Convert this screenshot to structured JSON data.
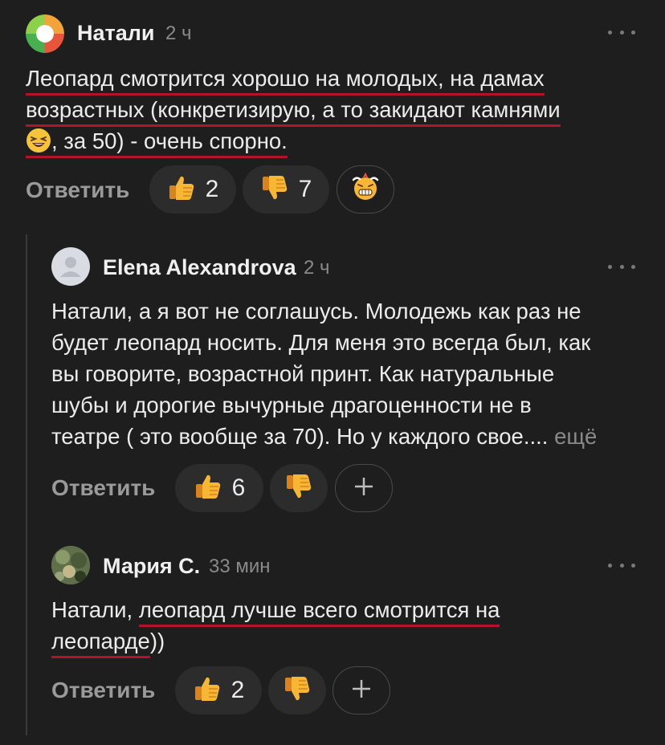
{
  "comments": [
    {
      "author": "Натали",
      "time": "2 ч",
      "text_lines": [
        "Леопард смотрится хорошо на молодых, на дамах",
        "возрастных (конкретизирую, а то закидают камнями",
        ", за 50) - очень спорно."
      ],
      "reply_label": "Ответить",
      "likes": "2",
      "dislikes": "7"
    },
    {
      "author": "Elena Alexandrova",
      "time": "2 ч",
      "text_lines": [
        "Натали, а я вот не соглашусь. Молодежь как раз не",
        "будет леопард носить. Для меня это всегда был, как",
        "вы говорите, возрастной принт. Как натуральные",
        "шубы и дорогие вычурные драгоценности не в",
        "театре ( это вообще за 70). Но у каждого свое...."
      ],
      "more_label": "ещё",
      "reply_label": "Ответить",
      "likes": "6"
    },
    {
      "author": "Мария С.",
      "time": "33 мин",
      "text_prefix": "Натали, ",
      "text_line1_underlined": "леопард лучше всего смотрится на",
      "text_line2_underlined": "леопарде",
      "text_line2_suffix": "))",
      "reply_label": "Ответить",
      "likes": "2"
    }
  ],
  "icons": {
    "like": "thumbs-up-icon",
    "dislike": "thumbs-down-icon",
    "add_reaction": "plus-icon",
    "menu": "more-dots-icon",
    "reaction": "grimace-emoji-icon",
    "laugh": "laughing-emoji-icon"
  },
  "colors": {
    "background": "#1e1e1e",
    "underline": "#b3122a",
    "thumb": "#f5a623"
  }
}
